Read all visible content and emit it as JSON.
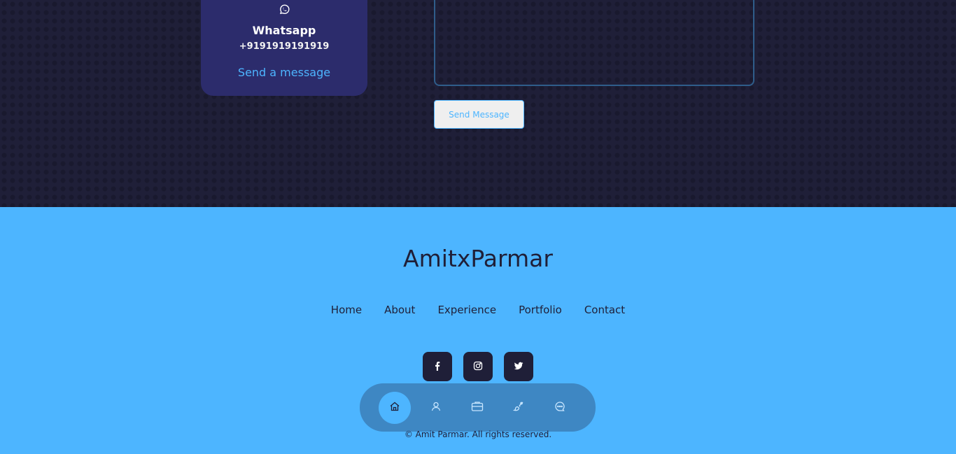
{
  "contact_card": {
    "title": "Whatsapp",
    "phone": "+9191919191919",
    "link_label": "Send a message",
    "icon": "whatsapp-icon"
  },
  "form": {
    "message_value": "",
    "submit_label": "Send Message"
  },
  "footer": {
    "logo": "AmitxParmar",
    "links": [
      "Home",
      "About",
      "Experience",
      "Portfolio",
      "Contact"
    ],
    "socials": [
      "facebook-icon",
      "instagram-icon",
      "twitter-icon"
    ],
    "copyright": "© Amit Parmar. All rights reserved."
  },
  "bottom_nav": {
    "items": [
      "home-icon",
      "user-icon",
      "briefcase-icon",
      "brush-icon",
      "chat-icon"
    ],
    "active": "home-icon"
  },
  "colors": {
    "background": "#1f1f38",
    "card": "#2c2c6c",
    "primary": "#4db5ff",
    "white": "#ffffff"
  }
}
